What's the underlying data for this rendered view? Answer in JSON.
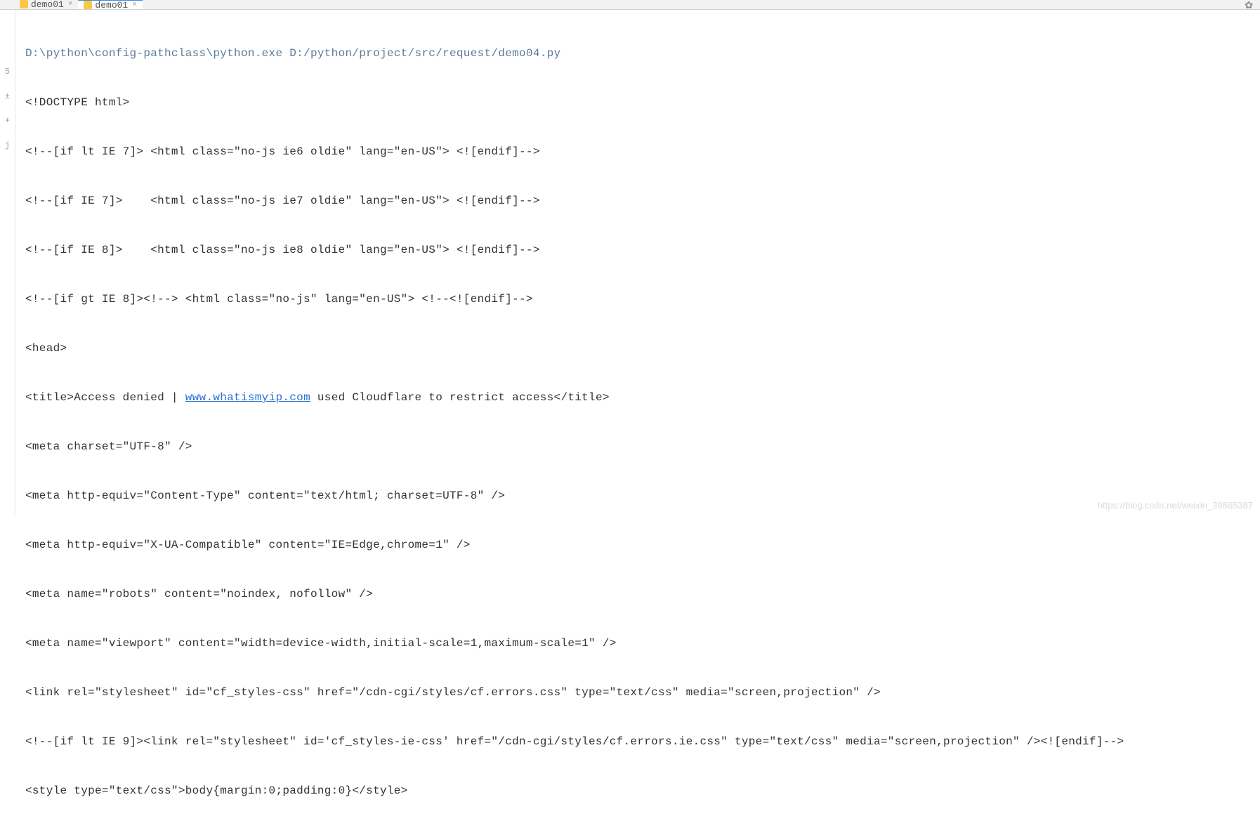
{
  "tabs": {
    "items": [
      {
        "label": "demo01",
        "active": false
      },
      {
        "label": "demo01",
        "active": true
      }
    ]
  },
  "gutter": {
    "items": [
      "",
      "",
      "5",
      "±",
      "+",
      "j"
    ]
  },
  "console": {
    "cmd": "D:\\python\\config-pathclass\\python.exe D:/python/project/src/request/demo04.py",
    "lines": [
      "<!DOCTYPE html>",
      "<!--[if lt IE 7]> <html class=\"no-js ie6 oldie\" lang=\"en-US\"> <![endif]-->",
      "<!--[if IE 7]>    <html class=\"no-js ie7 oldie\" lang=\"en-US\"> <![endif]-->",
      "<!--[if IE 8]>    <html class=\"no-js ie8 oldie\" lang=\"en-US\"> <![endif]-->",
      "<!--[if gt IE 8]><!--> <html class=\"no-js\" lang=\"en-US\"> <!--<![endif]-->",
      "<head>"
    ],
    "title_prefix": "<title>Access denied | ",
    "title_link": "www.whatismyip.com",
    "title_suffix": " used Cloudflare to restrict access</title>",
    "lines2": [
      "<meta charset=\"UTF-8\" />",
      "<meta http-equiv=\"Content-Type\" content=\"text/html; charset=UTF-8\" />",
      "<meta http-equiv=\"X-UA-Compatible\" content=\"IE=Edge,chrome=1\" />",
      "<meta name=\"robots\" content=\"noindex, nofollow\" />",
      "<meta name=\"viewport\" content=\"width=device-width,initial-scale=1,maximum-scale=1\" />",
      "<link rel=\"stylesheet\" id=\"cf_styles-css\" href=\"/cdn-cgi/styles/cf.errors.css\" type=\"text/css\" media=\"screen,projection\" />",
      "<!--[if lt IE 9]><link rel=\"stylesheet\" id='cf_styles-ie-css' href=\"/cdn-cgi/styles/cf.errors.ie.css\" type=\"text/css\" media=\"screen,projection\" /><![endif]-->",
      "<style type=\"text/css\">body{margin:0;padding:0}</style>"
    ]
  },
  "watermark": "https://blog.csdn.net/weixin_39865387"
}
